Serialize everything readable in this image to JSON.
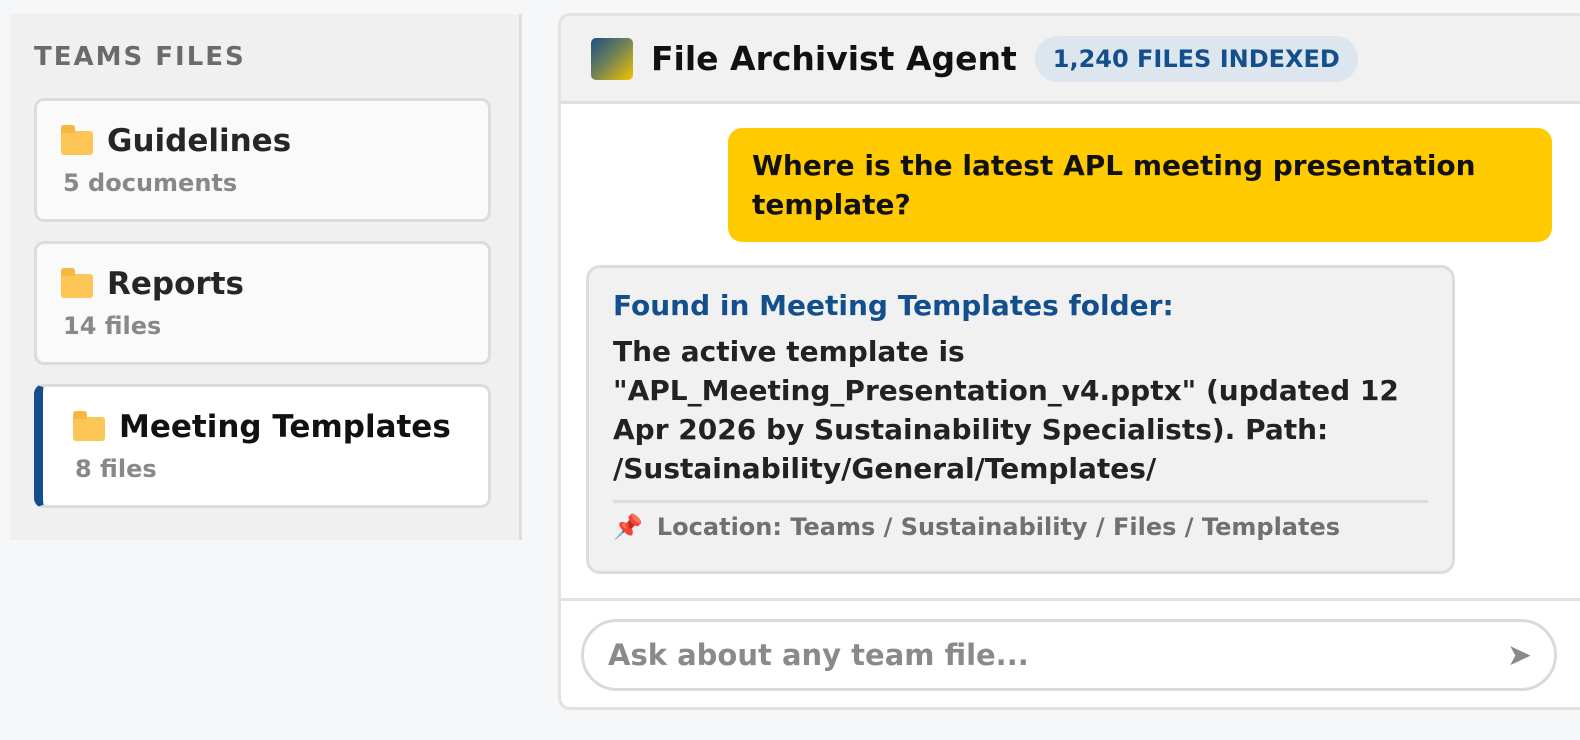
{
  "sidebar": {
    "title": "TEAMS FILES",
    "folders": [
      {
        "name": "Guidelines",
        "meta": "5 documents",
        "icon": "folder-icon",
        "active": false
      },
      {
        "name": "Reports",
        "meta": "14 files",
        "icon": "folder-icon",
        "active": false
      },
      {
        "name": "Meeting Templates",
        "meta": "8 files",
        "icon": "folder-icon",
        "active": true
      }
    ]
  },
  "chat": {
    "agent_name": "File Archivist Agent",
    "badge": "1,240 FILES INDEXED",
    "user_message": "Where is the latest APL meeting presentation template?",
    "agent_message": {
      "heading": "Found in Meeting Templates folder:",
      "body": "The active template is \"APL_Meeting_Presentation_v4.pptx\" (updated 12 Apr 2026 by Sustainability Specialists). Path: /Sustainability/General/Templates/",
      "location": "Location: Teams / Sustainability / Files / Templates",
      "location_icon": "pin-icon"
    },
    "input": {
      "placeholder": "Ask about any team file...",
      "value": "",
      "send_icon": "send-icon"
    }
  },
  "colors": {
    "accent_blue": "#134f8c",
    "user_bubble": "#ffcb00",
    "badge_bg": "#dde6ef",
    "folder_yellow": "#fbc655",
    "pin_red": "#d81b60"
  }
}
